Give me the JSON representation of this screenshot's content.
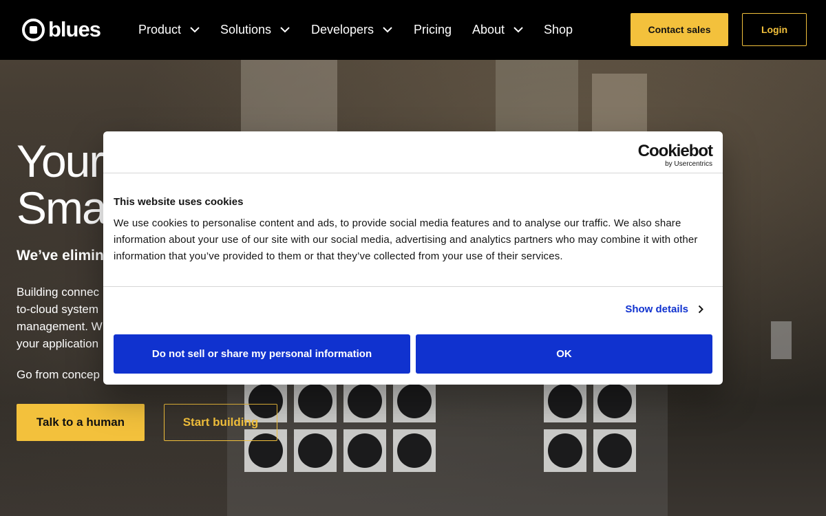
{
  "nav": {
    "logo_text": "blues",
    "items": [
      {
        "label": "Product",
        "has_dropdown": true
      },
      {
        "label": "Solutions",
        "has_dropdown": true
      },
      {
        "label": "Developers",
        "has_dropdown": true
      },
      {
        "label": "Pricing",
        "has_dropdown": false
      },
      {
        "label": "About",
        "has_dropdown": true
      },
      {
        "label": "Shop",
        "has_dropdown": false
      }
    ],
    "contact_label": "Contact sales",
    "login_label": "Login"
  },
  "hero": {
    "title_line1": "Your",
    "title_line2": "Sma",
    "subtitle": "We’ve elimin",
    "body_lines": [
      "Building connec",
      "to-cloud system",
      "management. W",
      "your application"
    ],
    "body2": "Go from concep",
    "talk_label": "Talk to a human",
    "start_label": "Start building"
  },
  "cookie": {
    "brand_main": "Cookiebot",
    "brand_sub": "by Usercentrics",
    "title": "This website uses cookies",
    "text": "We use cookies to personalise content and ads, to provide social media features and to analyse our traffic. We also share information about your use of our site with our social media, advertising and analytics partners who may combine it with other information that you’ve provided to them or that they’ve collected from your use of their services.",
    "show_details_label": "Show details",
    "dns_label": "Do not sell or share my personal information",
    "ok_label": "OK"
  },
  "colors": {
    "accent_yellow": "#f3c13c",
    "cookie_blue": "#1032cf",
    "nav_bg": "#000000"
  }
}
